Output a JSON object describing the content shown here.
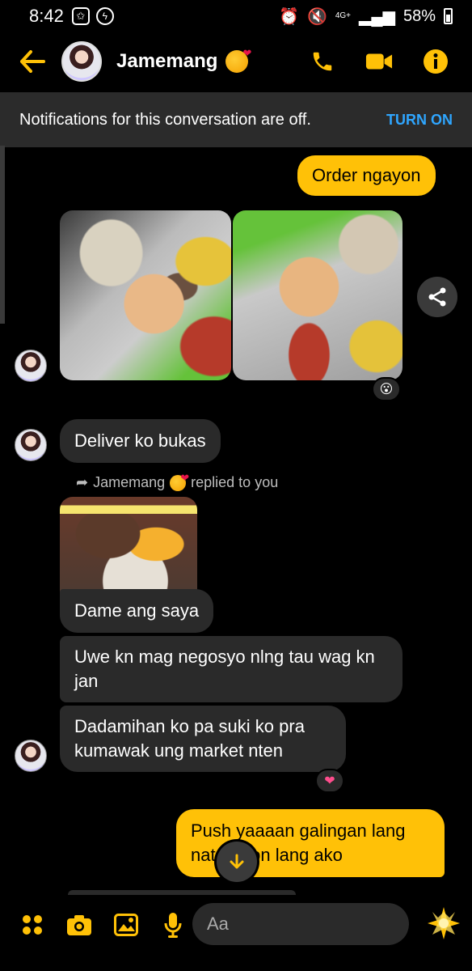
{
  "status_bar": {
    "time": "8:42",
    "network": "4G+",
    "battery": "58%"
  },
  "header": {
    "contact_name": "Jamemang",
    "name_emoji": "kiss-heart-emoji"
  },
  "notification": {
    "text": "Notifications for this conversation are off.",
    "action": "TURN ON"
  },
  "messages": {
    "order": "Order ngayon",
    "deliver": "Deliver ko bukas",
    "replied_name": "Jamemang",
    "replied_text": "replied to you",
    "dame": "Dame ang saya",
    "uwe": "Uwe kn mag negosyo nlng tau wag kn jan",
    "dadamihan": "Dadamihan ko pa suki ko pra kumawak ung market nten",
    "push_line1": "Push yaaaan galingan lang",
    "push_line2": "nat      ipon lang ako"
  },
  "reactions": {
    "photos": "surprised-emoji",
    "dadamihan": "heart-emoji"
  },
  "composer": {
    "placeholder": "Aa"
  },
  "colors": {
    "accent": "#ffc107",
    "link": "#2fa6ff",
    "bubble_them": "#2a2a2a"
  }
}
